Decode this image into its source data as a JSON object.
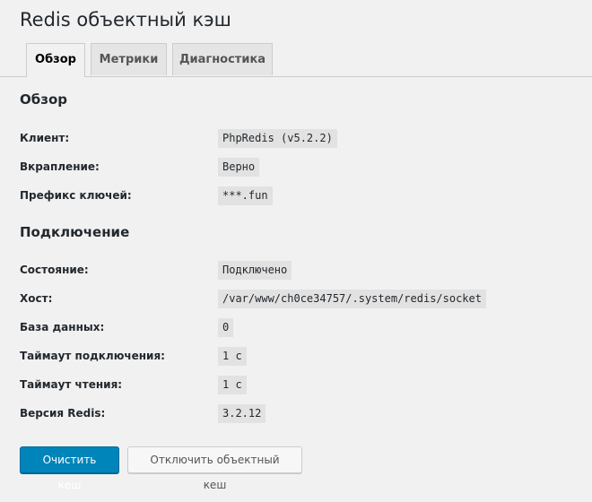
{
  "page": {
    "title": "Redis объектный кэш"
  },
  "tabs": [
    {
      "label": "Обзор",
      "active": true
    },
    {
      "label": "Метрики",
      "active": false
    },
    {
      "label": "Диагностика",
      "active": false
    }
  ],
  "overview": {
    "heading": "Обзор",
    "rows": [
      {
        "label": "Клиент:",
        "value": "PhpRedis (v5.2.2)"
      },
      {
        "label": "Вкрапление:",
        "value": "Верно"
      },
      {
        "label": "Префикс ключей:",
        "value": "***.fun"
      }
    ]
  },
  "connection": {
    "heading": "Подключение",
    "rows": [
      {
        "label": "Состояние:",
        "value": "Подключено"
      },
      {
        "label": "Хост:",
        "value": "/var/www/ch0ce34757/.system/redis/socket"
      },
      {
        "label": "База данных:",
        "value": "0"
      },
      {
        "label": "Таймаут подключения:",
        "value": "1 с"
      },
      {
        "label": "Таймаут чтения:",
        "value": "1 с"
      },
      {
        "label": "Версия Redis:",
        "value": "3.2.12"
      }
    ]
  },
  "actions": {
    "flush_label": "Очистить кеш",
    "disable_label": "Отключить объектный кеш"
  },
  "colors": {
    "primary": "#0085ba",
    "background": "#f1f1f1",
    "code_background": "#e2e2e2"
  }
}
